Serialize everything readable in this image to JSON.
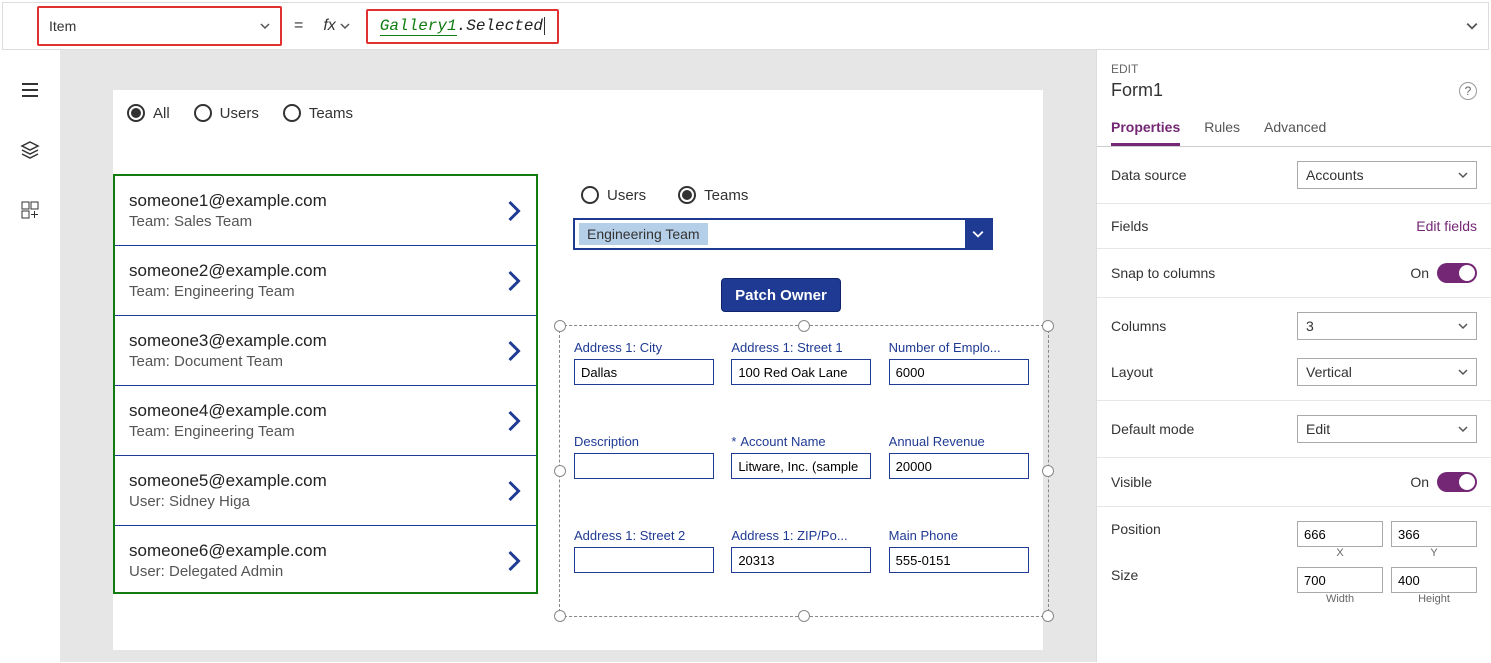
{
  "formula": {
    "property": "Item",
    "eq": "=",
    "fx": "fx",
    "ref": "Gallery1",
    "suffix": ".Selected"
  },
  "galleryFilter": {
    "all": "All",
    "users": "Users",
    "teams": "Teams",
    "selected": "All"
  },
  "galleryItems": [
    {
      "title": "someone1@example.com",
      "sub": "Team: Sales Team"
    },
    {
      "title": "someone2@example.com",
      "sub": "Team: Engineering Team"
    },
    {
      "title": "someone3@example.com",
      "sub": "Team: Document Team"
    },
    {
      "title": "someone4@example.com",
      "sub": "Team: Engineering Team"
    },
    {
      "title": "someone5@example.com",
      "sub": "User: Sidney Higa"
    },
    {
      "title": "someone6@example.com",
      "sub": "User: Delegated Admin"
    }
  ],
  "formFilter": {
    "users": "Users",
    "teams": "Teams",
    "selected": "Teams"
  },
  "teamSelect": "Engineering Team",
  "patchButton": "Patch Owner",
  "formFields": [
    {
      "label": "Address 1: City",
      "value": "Dallas",
      "required": false
    },
    {
      "label": "Address 1: Street 1",
      "value": "100 Red Oak Lane",
      "required": false
    },
    {
      "label": "Number of Emplo...",
      "value": "6000",
      "required": false
    },
    {
      "label": "Description",
      "value": "",
      "required": false
    },
    {
      "label": "Account Name",
      "value": "Litware, Inc. (sample",
      "required": true
    },
    {
      "label": "Annual Revenue",
      "value": "20000",
      "required": false
    },
    {
      "label": "Address 1: Street 2",
      "value": "",
      "required": false
    },
    {
      "label": "Address 1: ZIP/Po...",
      "value": "20313",
      "required": false
    },
    {
      "label": "Main Phone",
      "value": "555-0151",
      "required": false
    }
  ],
  "props": {
    "editLabel": "EDIT",
    "name": "Form1",
    "tabs": {
      "properties": "Properties",
      "rules": "Rules",
      "advanced": "Advanced"
    },
    "dataSource": {
      "label": "Data source",
      "value": "Accounts"
    },
    "fields": {
      "label": "Fields",
      "link": "Edit fields"
    },
    "snap": {
      "label": "Snap to columns",
      "value": "On"
    },
    "columns": {
      "label": "Columns",
      "value": "3"
    },
    "layout": {
      "label": "Layout",
      "value": "Vertical"
    },
    "defaultMode": {
      "label": "Default mode",
      "value": "Edit"
    },
    "visible": {
      "label": "Visible",
      "value": "On"
    },
    "position": {
      "label": "Position",
      "x": "666",
      "y": "366",
      "xl": "X",
      "yl": "Y"
    },
    "size": {
      "label": "Size",
      "w": "700",
      "h": "400",
      "wl": "Width",
      "hl": "Height"
    }
  }
}
